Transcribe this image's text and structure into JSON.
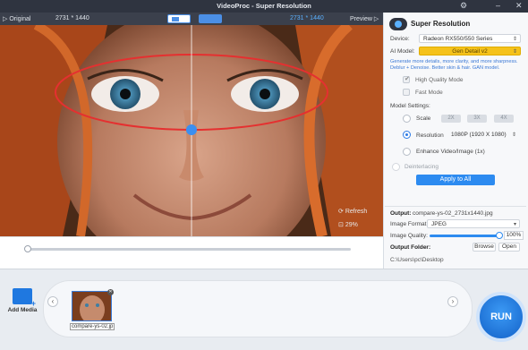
{
  "app": {
    "title": "VideoProc  -  Super Resolution",
    "settings_icon": "gear-icon",
    "minimize_icon": "minimize-icon",
    "close_icon": "close-icon"
  },
  "preview_bar": {
    "original_label": "Original",
    "original_res": "2731 * 1440",
    "output_res": "2731 * 1440",
    "preview_label": "Preview"
  },
  "preview": {
    "refresh_label": "Refresh",
    "zoom_label": "29%"
  },
  "panel": {
    "title": "Super Resolution",
    "device_label": "Device:",
    "device_value": "Radeon RX550/550 Series",
    "ai_model_label": "AI Model:",
    "ai_model_value": "Gen Detail v2",
    "ai_model_desc": "Generate more details, more clarity, and more sharpness. Deblur + Denoise. Better skin & hair. GAN model.",
    "high_quality_mode": "High Quality Mode",
    "fast_mode": "Fast Mode",
    "model_settings_label": "Model Settings:",
    "scale_label": "Scale",
    "scale_options": [
      "2X",
      "3X",
      "4X"
    ],
    "resolution_label": "Resolution",
    "resolution_value": "1080P (1920 X 1080)",
    "enhance_label": "Enhance Video/Image (1x)",
    "deinterlacing_label": "Deinterlacing",
    "apply_label": "Apply to All",
    "output_label": "Output:",
    "output_value": "compare-ys-02_2731x1440.jpg",
    "image_format_label": "Image Format:",
    "image_format_value": "JPEG",
    "image_quality_label": "Image Quality:",
    "image_quality_value": "100%",
    "image_quality_fraction": 1.0,
    "output_folder_label": "Output Folder:",
    "browse_label": "Browse",
    "open_label": "Open",
    "folder_path": "C:\\Users\\pc\\Desktop"
  },
  "bottom": {
    "add_media_label": "Add Media",
    "thumb_name": "compare-ys-02.jp",
    "run_label": "RUN"
  }
}
